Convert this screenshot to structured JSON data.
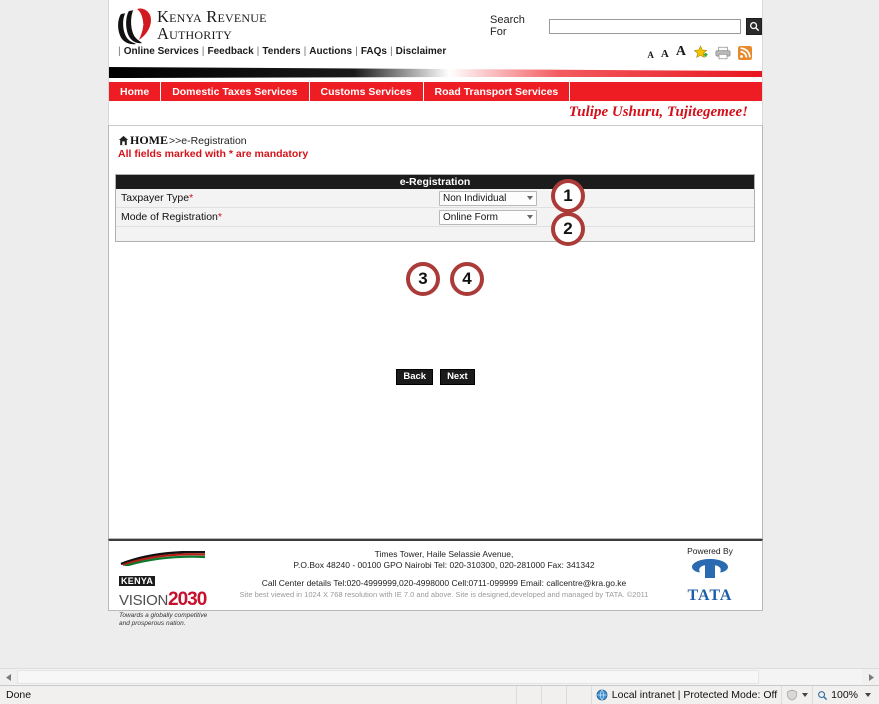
{
  "header": {
    "logo_line1": "Kenya Revenue",
    "logo_line2": "Authority",
    "logo_icon": "lion-head-icon",
    "search_label": "Search For",
    "search_value": "",
    "search_placeholder": "",
    "search_icon": "magnifier-icon",
    "quicklinks": [
      "Online Services",
      "Feedback",
      "Tenders",
      "Auctions",
      "FAQs",
      "Disclaimer"
    ],
    "tools": {
      "font_small": "A",
      "font_medium": "A",
      "font_large": "A",
      "favorites_icon": "star-icon",
      "print_icon": "printer-icon",
      "rss_icon": "rss-icon"
    }
  },
  "nav": {
    "items": [
      "Home",
      "Domestic Taxes Services",
      "Customs Services",
      "Road Transport Services"
    ],
    "tagline": "Tulipe Ushuru, Tujitegemee!"
  },
  "breadcrumb": {
    "home_icon": "home-icon",
    "home": "HOME",
    "trail": ">>e-Registration"
  },
  "notice": "All fields marked with * are mandatory",
  "form": {
    "title": "e-Registration",
    "fields": [
      {
        "label": "Taxpayer Type",
        "required": "*",
        "value": "Non Individual"
      },
      {
        "label": "Mode of Registration",
        "required": "*",
        "value": "Online Form"
      }
    ],
    "buttons": {
      "back": "Back",
      "next": "Next"
    }
  },
  "markers": [
    {
      "id": "1",
      "target": "taxpayer-type-dropdown"
    },
    {
      "id": "2",
      "target": "mode-of-registration-dropdown"
    },
    {
      "id": "3",
      "target": "back-button"
    },
    {
      "id": "4",
      "target": "next-button"
    }
  ],
  "footer": {
    "vision": {
      "kenya": "KENYA",
      "vision": "VISION",
      "year": "2030",
      "slogan_line1": "Towards a globally competitive",
      "slogan_line2": "and prosperous nation."
    },
    "address_line1": "Times Tower, Haile Selassie Avenue,",
    "address_line2": "P.O.Box 48240 - 00100 GPO Nairobi Tel: 020-310300, 020-281000 Fax: 341342",
    "callcenter": "Call Center details Tel:020-4999999,020-4998000 Cell:0711-099999 Email: callcentre@kra.go.ke",
    "bestviewed": "Site best viewed in 1024 X 768 resolution with IE 7.0 and above. Site is designed,developed and managed by TATA. ©2011",
    "powered_by": "Powered By",
    "tata": "TATA"
  },
  "statusbar": {
    "status": "Done",
    "zone_icon": "globe-icon",
    "zone": "Local intranet | Protected Mode: Off",
    "protected_icon": "shield-icon",
    "zoom_icon": "magnifier-icon",
    "zoom": "100%"
  },
  "colors": {
    "brand_red": "#ee1c23",
    "tagline_red": "#d4111a",
    "marker_red": "#aa3b39",
    "tata_blue": "#1b5fa8"
  }
}
